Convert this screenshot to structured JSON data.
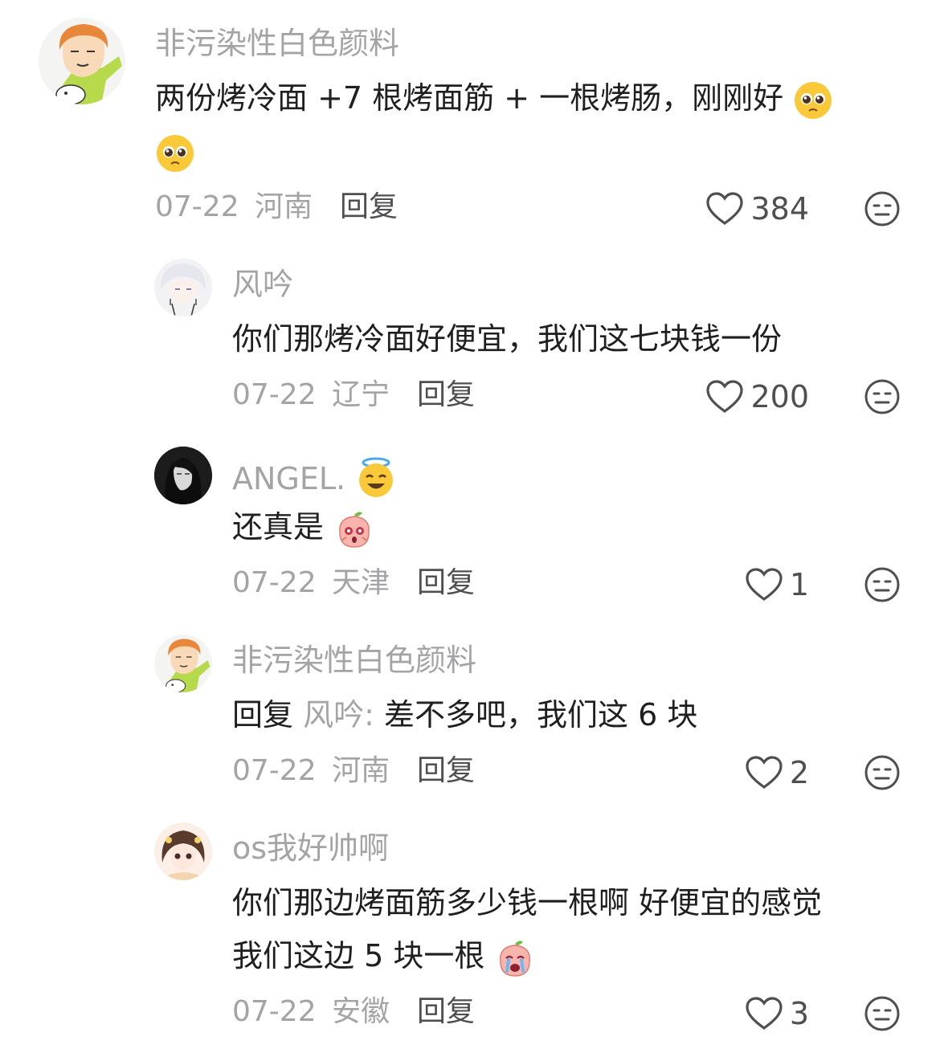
{
  "comments": [
    {
      "username": "非污染性白色颜料",
      "text_line1": "两份烤冷面 +7 根烤面筋 + 一根烤肠，刚刚好",
      "date": "07-22",
      "location": "河南",
      "reply_label": "回复",
      "likes": "384",
      "avatar_icon": "cartoon-girl-avatar",
      "emoji": "pleading-face-emoji"
    },
    {
      "username": "风吟",
      "text_line1": "你们那烤冷面好便宜，我们这七块钱一份",
      "date": "07-22",
      "location": "辽宁",
      "reply_label": "回复",
      "likes": "200",
      "avatar_icon": "anime-white-hair-avatar"
    },
    {
      "username": "ANGEL.",
      "text_line1": "还真是",
      "date": "07-22",
      "location": "天津",
      "reply_label": "回复",
      "likes": "1",
      "avatar_icon": "dark-portrait-avatar",
      "emoji": "peach-shocked-emoji",
      "name_emoji": "halo-smile-emoji"
    },
    {
      "username": "非污染性白色颜料",
      "reply_prefix": "回复",
      "reply_target": "风吟:",
      "text_line1": "差不多吧，我们这 6 块",
      "date": "07-22",
      "location": "河南",
      "reply_label": "回复",
      "likes": "2",
      "avatar_icon": "cartoon-girl-avatar"
    },
    {
      "username": "os我好帅啊",
      "text_line1": "你们那边烤面筋多少钱一根啊 好便宜的感觉",
      "text_line2": "我们这边 5 块一根",
      "date": "07-22",
      "location": "安徽",
      "reply_label": "回复",
      "likes": "3",
      "avatar_icon": "anime-girl-pigtails-avatar",
      "emoji": "peach-crying-emoji"
    }
  ],
  "colors": {
    "secondary_text": "#a4a4a7",
    "primary_text": "#1f1f1f",
    "action_text": "#4f4f52"
  }
}
